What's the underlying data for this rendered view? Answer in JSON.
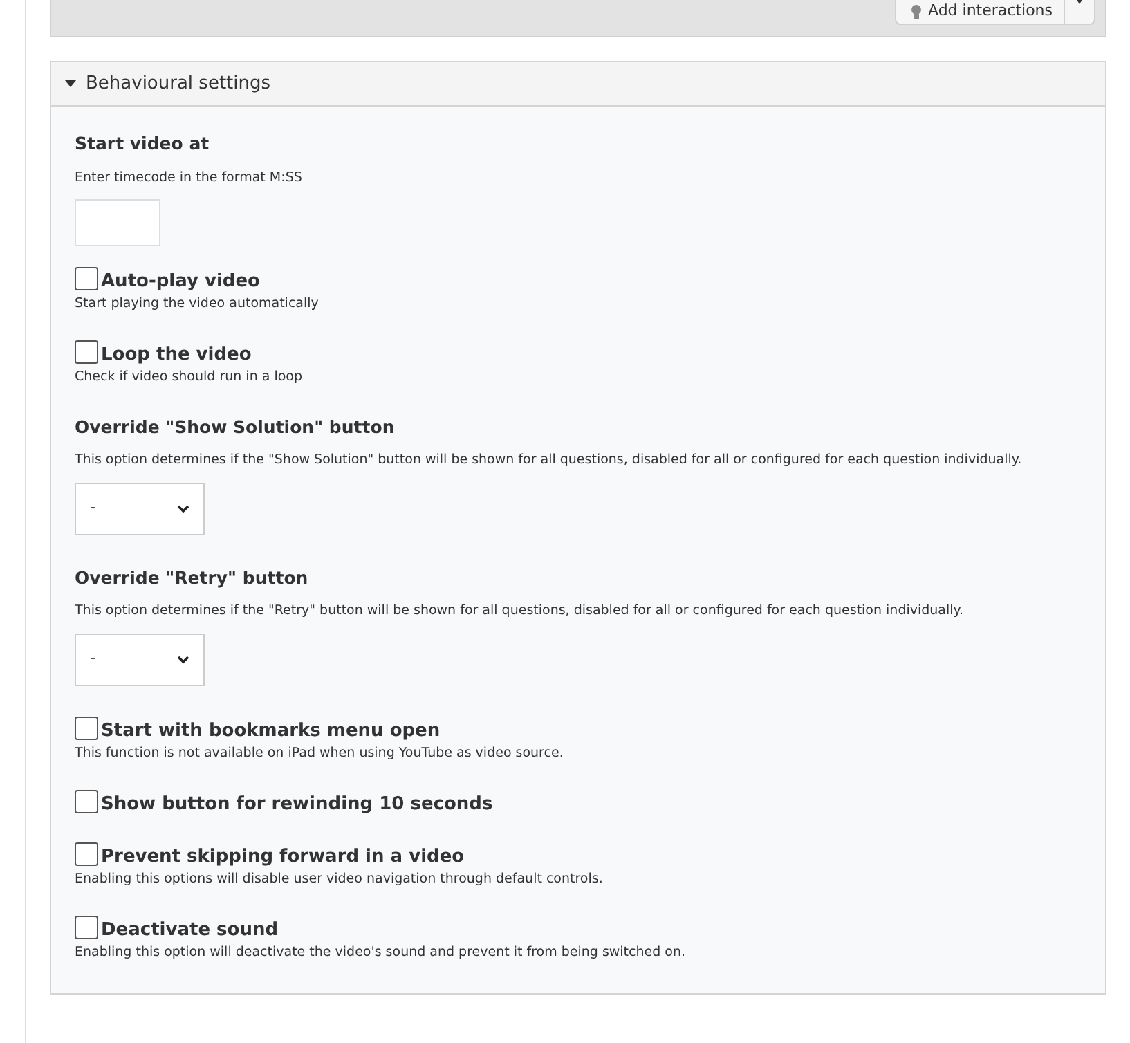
{
  "toolbar": {
    "button": "Add interactions"
  },
  "panel": {
    "title": "Behavioural settings",
    "expanded": true
  },
  "fields": [
    {
      "kind": "text",
      "label": "Start video at",
      "description": "Enter timecode in the format M:SS"
    },
    {
      "kind": "checkbox",
      "label": "Auto-play video",
      "description": "Start playing the video automatically",
      "checked": false
    },
    {
      "kind": "checkbox",
      "label": "Loop the video",
      "description": "Check if video should run in a loop",
      "checked": false
    },
    {
      "kind": "select",
      "label": "Override \"Show Solution\" button",
      "description": "This option determines if the \"Show Solution\" button will be shown for all questions, disabled for all or configured for each question individually.",
      "value": "-"
    },
    {
      "kind": "select",
      "label": "Override \"Retry\" button",
      "description": "This option determines if the \"Retry\" button will be shown for all questions, disabled for all or configured for each question individually.",
      "value": "-"
    },
    {
      "kind": "checkbox",
      "label": "Start with bookmarks menu open",
      "description": "This function is not available on iPad when using YouTube as video source.",
      "checked": false
    },
    {
      "kind": "checkbox",
      "label": "Show button for rewinding 10 seconds",
      "checked": false
    },
    {
      "kind": "checkbox",
      "label": "Prevent skipping forward in a video",
      "description": "Enabling this options will disable user video navigation through default controls.",
      "checked": false
    },
    {
      "kind": "checkbox",
      "label": "Deactivate sound",
      "description": "Enabling this option will deactivate the video's sound and prevent it from being switched on.",
      "checked": false
    }
  ]
}
